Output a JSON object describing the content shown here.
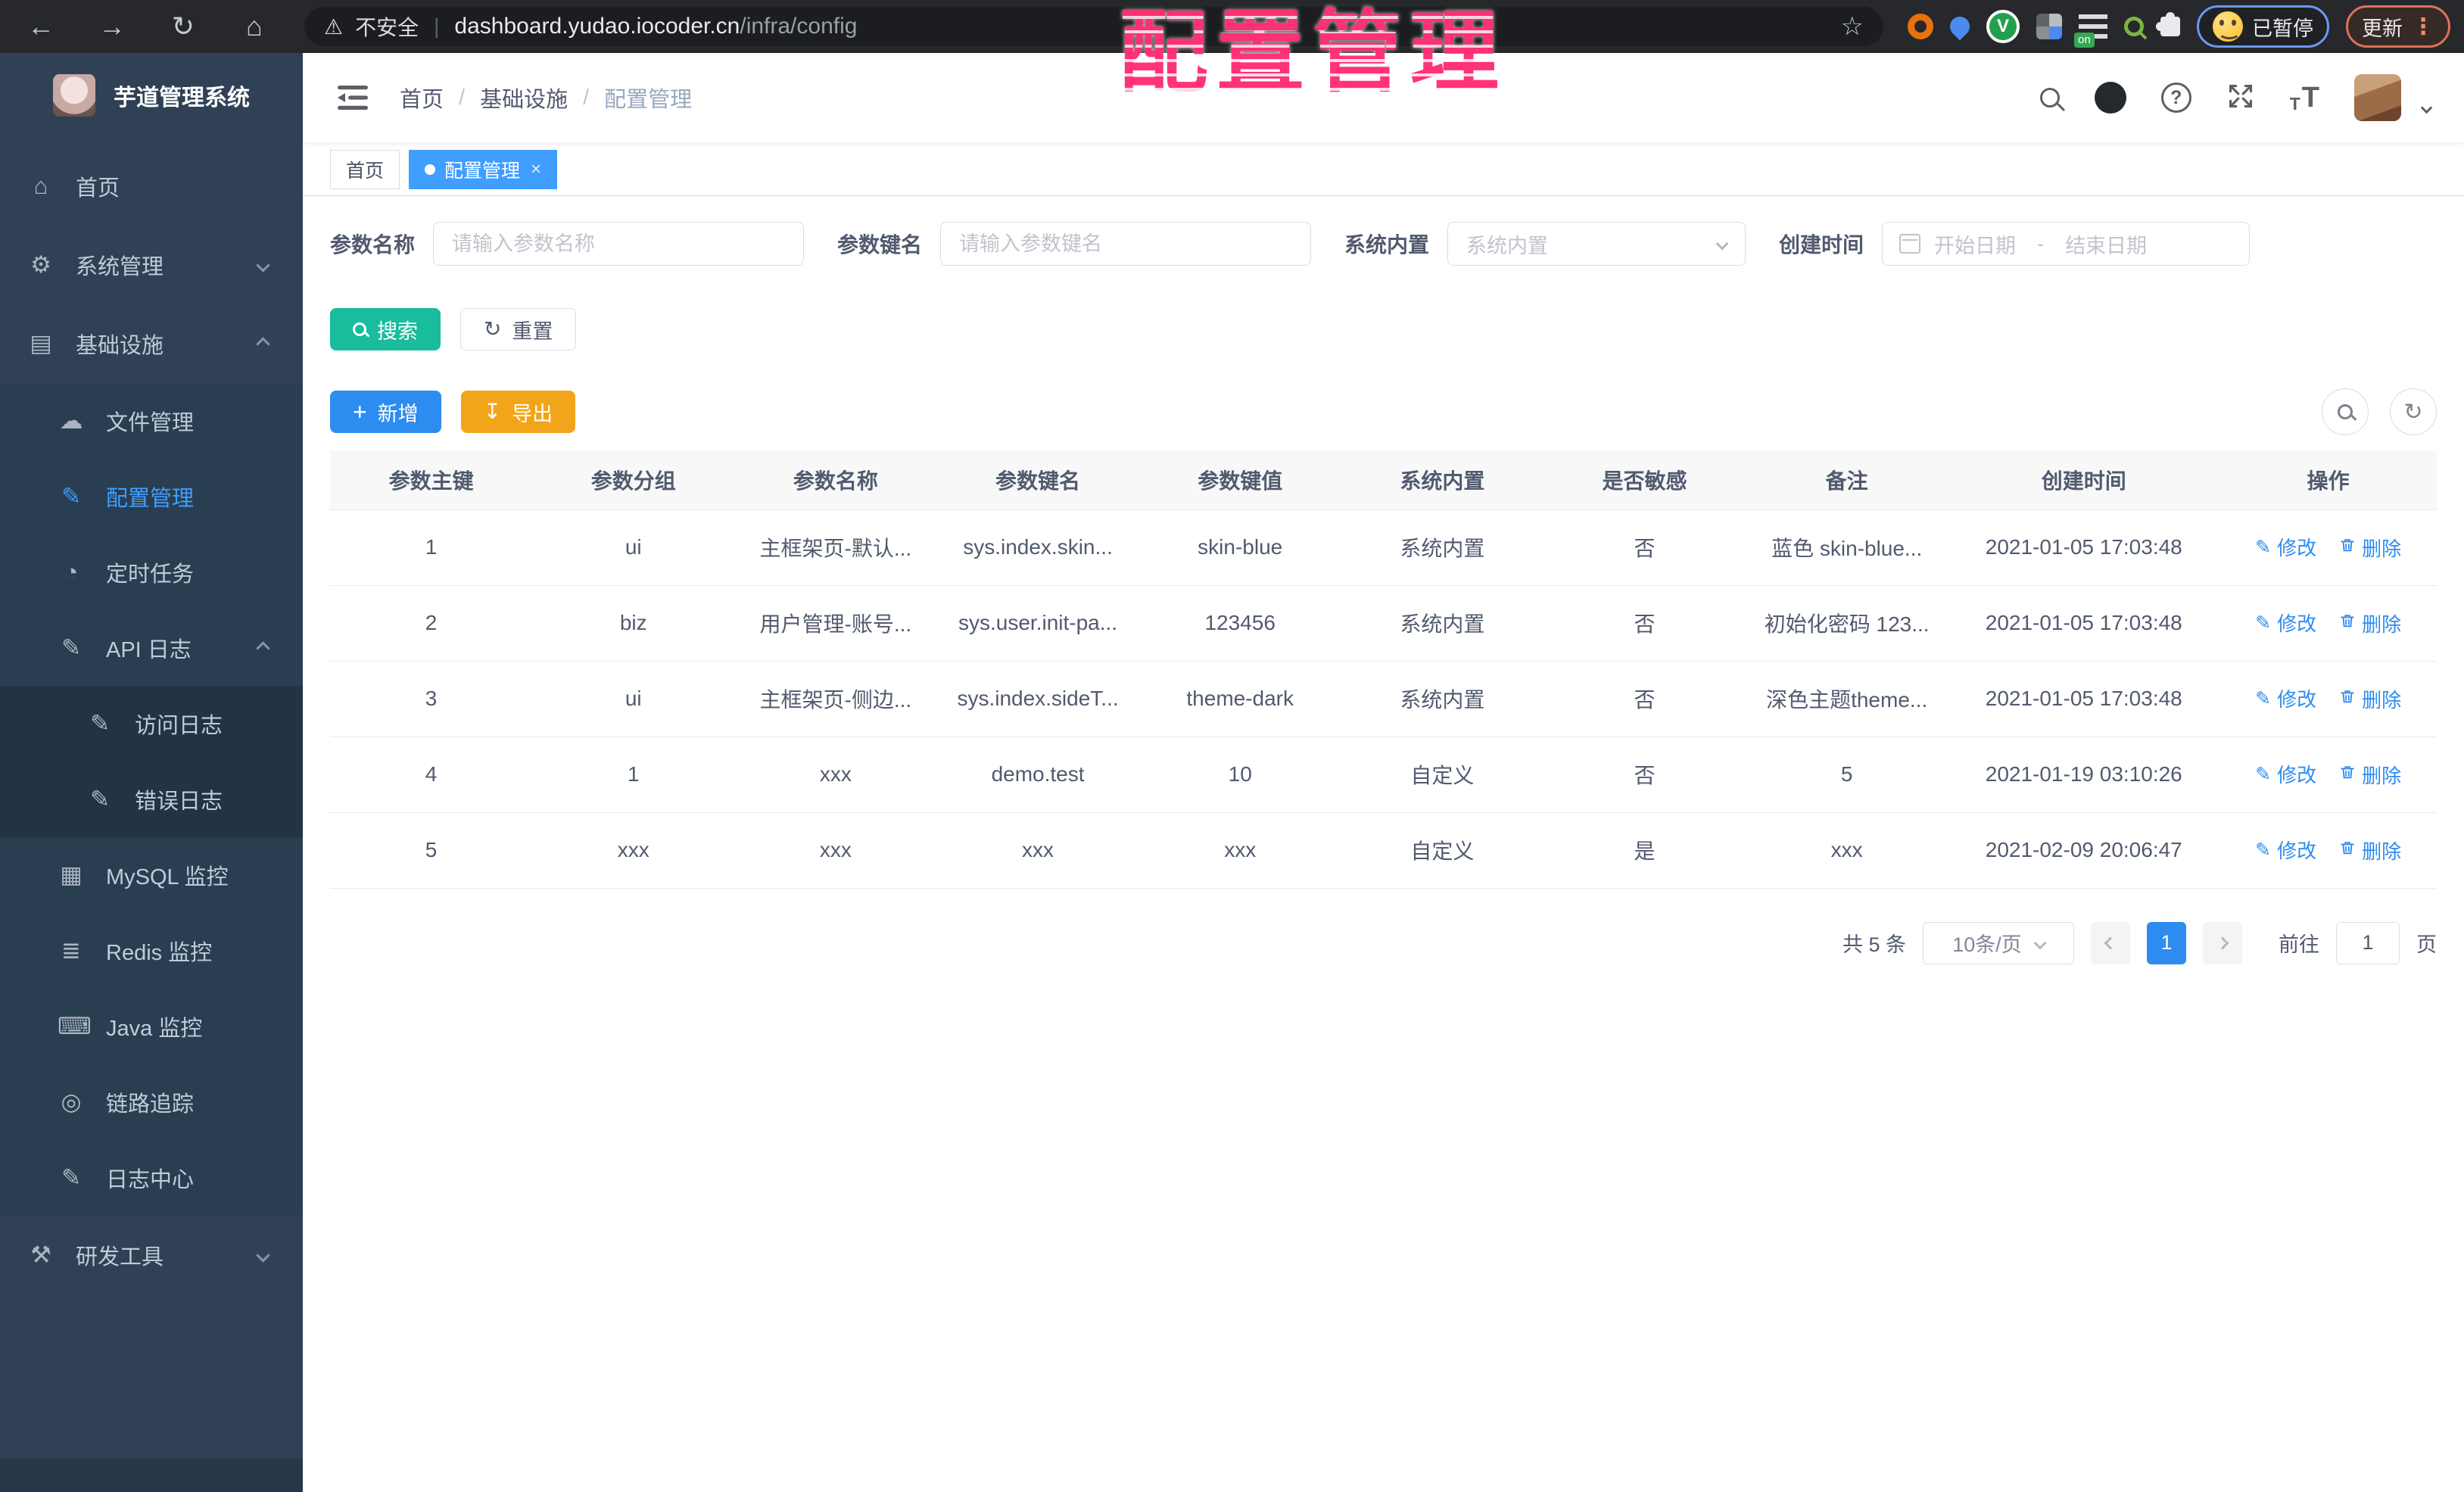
{
  "overlay_title": "配置管理",
  "browser": {
    "security_label": "不安全",
    "url_host": "dashboard.yudao.iocoder.cn",
    "url_path": "/infra/config",
    "extension_badge": "on",
    "profile_label": "已暂停",
    "update_label": "更新"
  },
  "sidebar": {
    "app_title": "芋道管理系统",
    "items": [
      {
        "name": "home",
        "label": "首页",
        "icon": "dashboard-icon",
        "level": 1,
        "active": false,
        "arrow": null
      },
      {
        "name": "system-management",
        "label": "系统管理",
        "icon": "gear-icon",
        "level": 1,
        "active": false,
        "arrow": "down"
      },
      {
        "name": "infrastructure",
        "label": "基础设施",
        "icon": "monitor-icon",
        "level": 1,
        "active": false,
        "arrow": "up"
      },
      {
        "name": "file-management",
        "label": "文件管理",
        "icon": "cloud-upload-icon",
        "level": 2,
        "active": false,
        "arrow": null
      },
      {
        "name": "config-management",
        "label": "配置管理",
        "icon": "edit-square-icon",
        "level": 2,
        "active": true,
        "arrow": null
      },
      {
        "name": "scheduled-jobs",
        "label": "定时任务",
        "icon": "timer-icon",
        "level": 2,
        "active": false,
        "arrow": null
      },
      {
        "name": "api-log",
        "label": "API 日志",
        "icon": "log-icon",
        "level": 2,
        "active": false,
        "arrow": "up"
      },
      {
        "name": "access-log",
        "label": "访问日志",
        "icon": "log-icon",
        "level": 3,
        "active": false,
        "arrow": null
      },
      {
        "name": "error-log",
        "label": "错误日志",
        "icon": "log-icon",
        "level": 3,
        "active": false,
        "arrow": null
      },
      {
        "name": "mysql-monitor",
        "label": "MySQL 监控",
        "icon": "database-grid-icon",
        "level": 2,
        "active": false,
        "arrow": null
      },
      {
        "name": "redis-monitor",
        "label": "Redis 监控",
        "icon": "layers-icon",
        "level": 2,
        "active": false,
        "arrow": null
      },
      {
        "name": "java-monitor",
        "label": "Java 监控",
        "icon": "computer-icon",
        "level": 2,
        "active": false,
        "arrow": null
      },
      {
        "name": "link-tracing",
        "label": "链路追踪",
        "icon": "eye-icon",
        "level": 2,
        "active": false,
        "arrow": null
      },
      {
        "name": "log-center",
        "label": "日志中心",
        "icon": "log-icon",
        "level": 2,
        "active": false,
        "arrow": null
      },
      {
        "name": "dev-tools",
        "label": "研发工具",
        "icon": "tools-icon",
        "level": 1,
        "active": false,
        "arrow": "down"
      }
    ]
  },
  "navbar": {
    "breadcrumb": [
      "首页",
      "基础设施",
      "配置管理"
    ]
  },
  "tabs": [
    {
      "name": "home",
      "label": "首页",
      "active": false,
      "closable": false
    },
    {
      "name": "config-management",
      "label": "配置管理",
      "active": true,
      "closable": true
    }
  ],
  "filters": {
    "name_label": "参数名称",
    "name_placeholder": "请输入参数名称",
    "key_label": "参数键名",
    "key_placeholder": "请输入参数键名",
    "type_label": "系统内置",
    "type_placeholder": "系统内置",
    "date_label": "创建时间",
    "date_start_placeholder": "开始日期",
    "date_separator": "-",
    "date_end_placeholder": "结束日期",
    "search_label": "搜索",
    "reset_label": "重置"
  },
  "toolbar": {
    "add_label": "新增",
    "export_label": "导出"
  },
  "table": {
    "columns": [
      "参数主键",
      "参数分组",
      "参数名称",
      "参数键名",
      "参数键值",
      "系统内置",
      "是否敏感",
      "备注",
      "创建时间",
      "操作"
    ],
    "rows": [
      {
        "cells": [
          "1",
          "ui",
          "主框架页-默认...",
          "sys.index.skin...",
          "skin-blue",
          "系统内置",
          "否",
          "蓝色 skin-blue...",
          "2021-01-05 17:03:48"
        ]
      },
      {
        "cells": [
          "2",
          "biz",
          "用户管理-账号...",
          "sys.user.init-pa...",
          "123456",
          "系统内置",
          "否",
          "初始化密码 123...",
          "2021-01-05 17:03:48"
        ]
      },
      {
        "cells": [
          "3",
          "ui",
          "主框架页-侧边...",
          "sys.index.sideT...",
          "theme-dark",
          "系统内置",
          "否",
          "深色主题theme...",
          "2021-01-05 17:03:48"
        ]
      },
      {
        "cells": [
          "4",
          "1",
          "xxx",
          "demo.test",
          "10",
          "自定义",
          "否",
          "5",
          "2021-01-19 03:10:26"
        ]
      },
      {
        "cells": [
          "5",
          "xxx",
          "xxx",
          "xxx",
          "xxx",
          "自定义",
          "是",
          "xxx",
          "2021-02-09 20:06:47"
        ]
      }
    ],
    "edit_label": "修改",
    "delete_label": "删除"
  },
  "pagination": {
    "total_label": "共 5 条",
    "page_size_label": "10条/页",
    "current_page": "1",
    "goto_label": "前往",
    "goto_value": "1",
    "page_unit_label": "页"
  },
  "colors": {
    "accent_blue": "#409EFF",
    "link_blue": "#2D8CF0",
    "search_teal": "#19BC9C",
    "export_orange": "#F2A51A",
    "sidebar_bg": "#304156",
    "overlay_pink": "#FF2B70"
  }
}
